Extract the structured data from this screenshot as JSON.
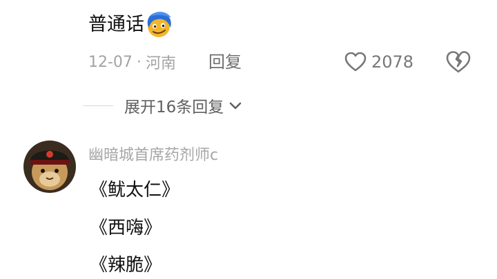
{
  "comment1": {
    "text": "普通话",
    "emoji_icon": "smirk-emoji-icon",
    "date": "12-07",
    "separator": "·",
    "location": "河南",
    "reply_label": "回复",
    "like_count": "2078",
    "expand_label": "展开16条回复"
  },
  "comment2": {
    "username": "幽暗城首席药剂师c",
    "lines": [
      "《鱿太仁》",
      "《西嗨》",
      "《辣脆》"
    ]
  },
  "colors": {
    "meta": "#a3a3a3",
    "icon": "#777777",
    "text": "#111111"
  }
}
